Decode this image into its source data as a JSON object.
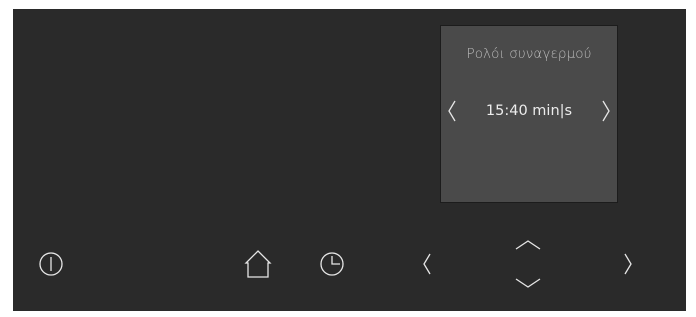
{
  "display": {
    "title": "Ρολόι συναγερμού",
    "value": "15:40 min|s",
    "left_arrow_icon": "chevron-left-icon",
    "right_arrow_icon": "chevron-right-icon"
  },
  "controls": {
    "power_icon": "power-icon",
    "home_icon": "home-icon",
    "clock_icon": "clock-icon",
    "prev_icon": "chevron-left-icon",
    "up_icon": "chevron-up-icon",
    "down_icon": "chevron-down-icon",
    "next_icon": "chevron-right-icon"
  },
  "colors": {
    "panel_background": "#2a2a2a",
    "display_background": "#4a4a4a",
    "icon_color": "#e6e6e6",
    "title_color": "#bdbdbd",
    "value_color": "#ececec"
  }
}
